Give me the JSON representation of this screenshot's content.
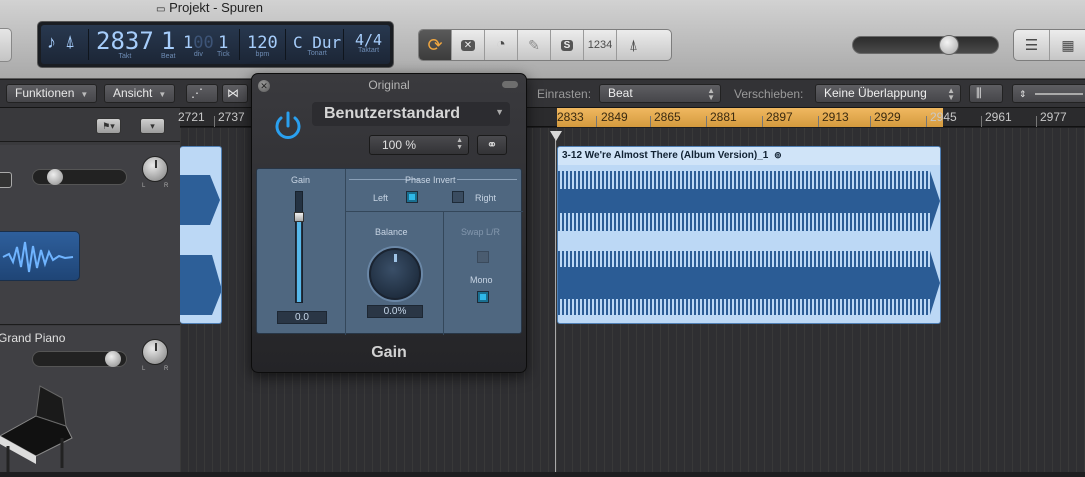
{
  "window": {
    "title": "Projekt - Spuren"
  },
  "lcd": {
    "bar": "2837",
    "beat": "1",
    "div": "1",
    "div_dim": "00",
    "tick": "1",
    "bar_label": "Takt",
    "beat_label": "Beat",
    "div_label": "div",
    "tick_label": "Tick",
    "tempo": "120",
    "tempo_label": "bpm",
    "key": "C Dur",
    "key_label": "Tonart",
    "timesig": "4/4",
    "timesig_label": "Taktart"
  },
  "toolbar": {
    "count_in_label": "1234",
    "solo_label": "S"
  },
  "row2": {
    "functions_label": "Funktionen",
    "view_label": "Ansicht",
    "snap_label": "Einrasten:",
    "snap_value": "Beat",
    "drag_label": "Verschieben:",
    "drag_value": "Keine Überlappung"
  },
  "ruler": {
    "ticks": [
      "2721",
      "2737",
      "2833",
      "2849",
      "2865",
      "2881",
      "2897",
      "2913",
      "2929",
      "2945",
      "2961",
      "2977"
    ]
  },
  "tracks": {
    "track2_name": "Grand Piano"
  },
  "region": {
    "name": "3-12 We're Almost There (Album Version)_1"
  },
  "plugin": {
    "title": "Original",
    "preset": "Benutzerstandard",
    "zoom": "100 %",
    "gain_label": "Gain",
    "gain_value": "0.0",
    "phase_invert_label": "Phase Invert",
    "left_label": "Left",
    "right_label": "Right",
    "balance_label": "Balance",
    "balance_value": "0.0%",
    "swap_label": "Swap L/R",
    "mono_label": "Mono",
    "footer_name": "Gain"
  },
  "colors": {
    "accent_orange": "#f0a640",
    "region_blue": "#bcd8f5",
    "plugin_panel": "#4f6780",
    "power_blue": "#2aa0ef"
  }
}
